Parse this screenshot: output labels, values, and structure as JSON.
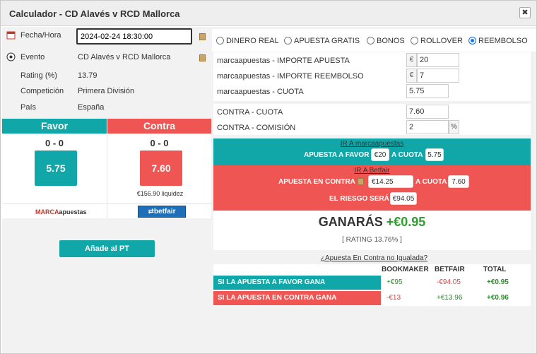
{
  "window": {
    "title": "Calculador - CD Alavés v RCD Mallorca",
    "close_label": "✖"
  },
  "info": {
    "fecha_label": "Fecha/Hora",
    "fecha_value": "2024-02-24 18:30:00",
    "evento_label": "Evento",
    "evento_value": "CD Alavés v RCD Mallorca",
    "rating_label": "Rating (%)",
    "rating_value": "13.79",
    "competicion_label": "Competición",
    "competicion_value": "Primera División",
    "pais_label": "País",
    "pais_value": "España"
  },
  "favor": {
    "header": "Favor",
    "score": "0 - 0",
    "odds": "5.75",
    "color": "#11a7a9",
    "logo": "MARCAapuestas"
  },
  "contra": {
    "header": "Contra",
    "score": "0 - 0",
    "odds": "7.60",
    "color": "#ef5552",
    "liquidity": "€156.90 liquidez",
    "logo": "betfair"
  },
  "pt_button": "Añade al PT",
  "modes": {
    "options": [
      "DINERO REAL",
      "APUESTA GRATIS",
      "BONOS",
      "ROLLOVER",
      "REEMBOLSO"
    ],
    "selected": "REEMBOLSO"
  },
  "bookmaker_fields": {
    "importe_apuesta_label": "marcaapuestas - IMPORTE APUESTA",
    "importe_apuesta_currency": "€",
    "importe_apuesta_value": "20",
    "importe_reembolso_label": "marcaapuestas - IMPORTE REEMBOLSO",
    "importe_reembolso_currency": "€",
    "importe_reembolso_value": "7",
    "cuota_label": "marcaapuestas - CUOTA",
    "cuota_value": "5.75"
  },
  "contra_fields": {
    "cuota_label": "CONTRA - CUOTA",
    "cuota_value": "7.60",
    "comision_label": "CONTRA - COMISIÓN",
    "comision_value": "2",
    "comision_unit": "%"
  },
  "favor_bet": {
    "link": "IR A marcaapuestas",
    "text1": "APUESTA A FAVOR",
    "amount": "€20",
    "text2": "A CUOTA",
    "odds": "5.75"
  },
  "contra_bet": {
    "link": "IR A Betfair",
    "text1": "APUESTA EN CONTRA",
    "amount": "€14.25",
    "text2": "A CUOTA",
    "odds": "7.60",
    "risk_label": "EL RIESGO SERÁ",
    "risk_value": "€94.05"
  },
  "result": {
    "label": "GANARÁS",
    "value": "+€0.95",
    "rating": "[ RATING 13.76% ]"
  },
  "unmatched_link": "¿Apuesta En Contra no Igualada?",
  "table": {
    "headers": [
      "BOOKMAKER",
      "BETFAIR",
      "TOTAL"
    ],
    "rows": [
      {
        "label": "SI LA APUESTA A FAVOR GANA",
        "bookmaker": "+€95",
        "betfair": "-€94.05",
        "total": "+€0.95"
      },
      {
        "label": "SI LA APUESTA EN CONTRA GANA",
        "bookmaker": "-€13",
        "betfair": "+€13.96",
        "total": "+€0.96"
      }
    ]
  }
}
